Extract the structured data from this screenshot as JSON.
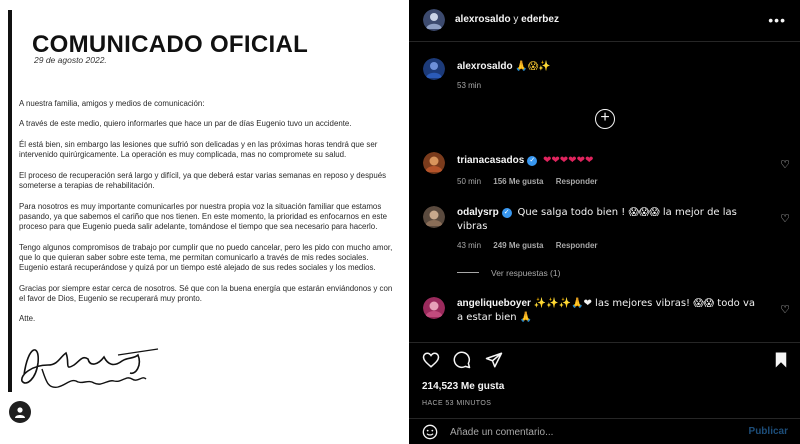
{
  "document": {
    "title": "COMUNICADO OFICIAL",
    "date": "29 de agosto 2022.",
    "paragraphs": [
      "A nuestra familia, amigos y medios de comunicación:",
      "A través de este medio, quiero informarles que hace un par de días Eugenio tuvo un accidente.",
      "Él está bien, sin embargo las lesiones que sufrió son delicadas y en las próximas horas tendrá que ser intervenido quirúrgicamente. La operación es muy complicada, mas no compromete su salud.",
      "El proceso de recuperación será largo y difícil, ya que deberá estar varias semanas en reposo y después someterse a terapias de rehabilitación.",
      "Para nosotros es muy importante comunicarles por nuestra propia voz la situación familiar que estamos pasando, ya que sabemos el cariño que nos tienen. En este momento, la prioridad es enfocarnos en este proceso para que Eugenio pueda salir adelante, tomándose el tiempo que sea necesario para hacerlo.",
      "Tengo algunos compromisos de trabajo por cumplir que no puedo cancelar, pero les pido con mucho amor, que lo que quieran saber sobre este tema, me permitan comunicarlo a través de mis redes sociales. Eugenio estará recuperándose y quizá por un tiempo esté alejado de sus redes sociales y los medios.",
      "Gracias por siempre estar cerca de nosotros. Sé que con la buena energía que estarán enviándonos y con el favor de Dios, Eugenio se recuperará muy pronto.",
      "Atte."
    ]
  },
  "header": {
    "user1": "alexrosaldo",
    "connector": "y",
    "user2": "ederbez",
    "more_label": "•••"
  },
  "caption": {
    "username": "alexrosaldo",
    "emojis": "🙏😱✨",
    "time": "53 min"
  },
  "plus_label": "+",
  "comments": [
    {
      "username": "trianacasados",
      "text": "❤❤❤❤❤❤",
      "time": "50 min",
      "likes": "156 Me gusta",
      "reply": "Responder"
    },
    {
      "username": "odalysrp",
      "text": "Que salga todo bien ! 😱😱😱 la mejor de las vibras",
      "time": "43 min",
      "likes": "249 Me gusta",
      "reply": "Responder"
    },
    {
      "username": "angeliqueboyer",
      "text": "✨✨✨🙏❤ las mejores vibras! 😱😱 todo va a estar bien 🙏",
      "time": "",
      "likes": "",
      "reply": ""
    }
  ],
  "view_replies": "Ver respuestas (1)",
  "likes_count": "214,523 Me gusta",
  "timestamp": "HACE 53 MINUTOS",
  "add_comment": {
    "placeholder": "Añade un comentario...",
    "post_label": "Publicar"
  },
  "colors": {
    "background": "#000000",
    "verified": "#3897f0",
    "heart": "#e0245e",
    "post_button": "#1d4e7a"
  }
}
